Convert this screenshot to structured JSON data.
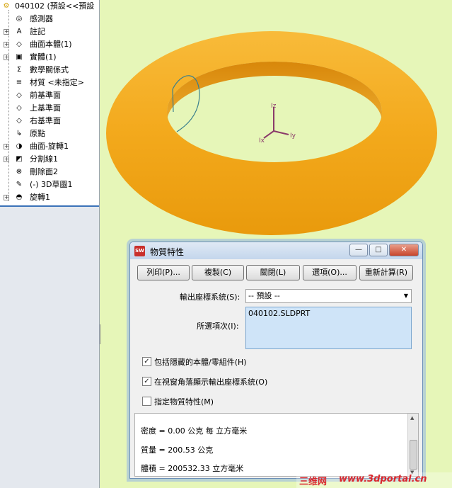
{
  "tree": {
    "root_label": "040102 (預設<<預設",
    "items": [
      {
        "label": "感測器",
        "icon": "sensor-icon",
        "glyph": "◎",
        "expandable": false
      },
      {
        "label": "註記",
        "icon": "annotation-icon",
        "glyph": "A",
        "expandable": true
      },
      {
        "label": "曲面本體(1)",
        "icon": "surface-body-icon",
        "glyph": "◇",
        "expandable": true
      },
      {
        "label": "實體(1)",
        "icon": "solid-body-icon",
        "glyph": "▣",
        "expandable": true
      },
      {
        "label": "數學關係式",
        "icon": "equation-icon",
        "glyph": "Σ",
        "expandable": false
      },
      {
        "label": "材質 <未指定>",
        "icon": "material-icon",
        "glyph": "≡",
        "expandable": false
      },
      {
        "label": "前基準面",
        "icon": "plane-icon",
        "glyph": "◇",
        "expandable": false
      },
      {
        "label": "上基準面",
        "icon": "plane-icon",
        "glyph": "◇",
        "expandable": false
      },
      {
        "label": "右基準面",
        "icon": "plane-icon",
        "glyph": "◇",
        "expandable": false
      },
      {
        "label": "原點",
        "icon": "origin-icon",
        "glyph": "↳",
        "expandable": false
      },
      {
        "label": "曲面-旋轉1",
        "icon": "surface-revolve-icon",
        "glyph": "◑",
        "expandable": true
      },
      {
        "label": "分割線1",
        "icon": "split-line-icon",
        "glyph": "◩",
        "expandable": true
      },
      {
        "label": "刪除面2",
        "icon": "delete-face-icon",
        "glyph": "⊗",
        "expandable": false
      },
      {
        "label": "(-) 3D草圖1",
        "icon": "3d-sketch-icon",
        "glyph": "✎",
        "expandable": false
      },
      {
        "label": "旋轉1",
        "icon": "revolve-icon",
        "glyph": "◓",
        "expandable": true
      }
    ]
  },
  "axes": {
    "y_label": "Iz",
    "x_label": "Ix",
    "z_label": "Iy"
  },
  "colors": {
    "part": "#f0a418",
    "viewport_bg": "#e6f6b8",
    "sketch_line": "#3a7f8c"
  },
  "dialog": {
    "title": "物質特性",
    "buttons": [
      "列印(P)...",
      "複製(C)",
      "關閉(L)",
      "選項(O)...",
      "重新計算(R)"
    ],
    "coord_label": "輸出座標系統(S):",
    "coord_value": "-- 預設 --",
    "selected_label": "所選項次(I):",
    "selected_item": "040102.SLDPRT",
    "checkboxes": [
      {
        "label": "包括隱藏的本體/零組件(H)",
        "checked": true
      },
      {
        "label": "在視窗角落顯示輸出座標系統(O)",
        "checked": true
      },
      {
        "label": "指定物質特性(M)",
        "checked": false
      }
    ],
    "results": [
      "密度 = 0.00 公克 每 立方毫米",
      "質量 = 200.53 公克",
      "體積 = 200532.33 立方毫米"
    ]
  },
  "watermark": {
    "text1": "三维网",
    "text2": "www.3dportal.cn"
  }
}
